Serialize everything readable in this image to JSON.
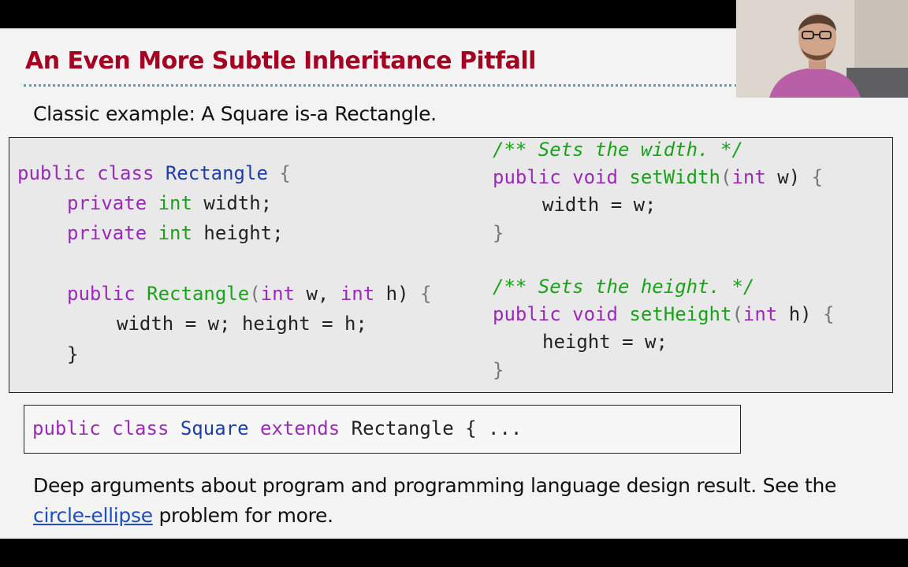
{
  "slide": {
    "title": "An Even More Subtle Inheritance Pitfall",
    "subtitle": "Classic example: A Square is-a Rectangle.",
    "code_left": {
      "l1_kw1": "public",
      "l1_kw2": "class",
      "l1_cls": "Rectangle",
      "l1_brace": "{",
      "l2_kw": "private",
      "l2_ty": "int",
      "l2_rest": "width;",
      "l3_kw": "private",
      "l3_ty": "int",
      "l3_rest": "height;",
      "l4_kw": "public",
      "l4_name": "Rectangle",
      "l4_p1": "(",
      "l4_ty1": "int",
      "l4_p2": "w,",
      "l4_ty2": "int",
      "l4_p3": "h)",
      "l4_brace": "{",
      "l5": "width = w; height = h;",
      "l6": "}"
    },
    "code_right": {
      "c1": "/** Sets the width. */",
      "m1_kw1": "public",
      "m1_kw2": "void",
      "m1_name": "setWidth",
      "m1_p1": "(",
      "m1_ty": "int",
      "m1_p2": "w)",
      "m1_brace": "{",
      "m1_body": "width = w;",
      "m1_close": "}",
      "c2": "/** Sets the height. */",
      "m2_kw1": "public",
      "m2_kw2": "void",
      "m2_name": "setHeight",
      "m2_p1": "(",
      "m2_ty": "int",
      "m2_p2": "h)",
      "m2_brace": "{",
      "m2_body": "height = w;",
      "m2_close": "}"
    },
    "code_square": {
      "kw1": "public",
      "kw2": "class",
      "cls": "Square",
      "kw3": "extends",
      "rest": "Rectangle { ..."
    },
    "body": {
      "text1": "Deep arguments about program and programming language design result. See the ",
      "link": "circle-ellipse",
      "text2": " problem for more."
    }
  },
  "colors": {
    "title": "#a50021",
    "keyword": "#9b2ab8",
    "type": "#1aa31a",
    "class_name": "#1d3fa8",
    "comment": "#1aa31a",
    "link": "#1f4fbf"
  },
  "webcam": {
    "icon": "presenter-webcam-feed"
  }
}
